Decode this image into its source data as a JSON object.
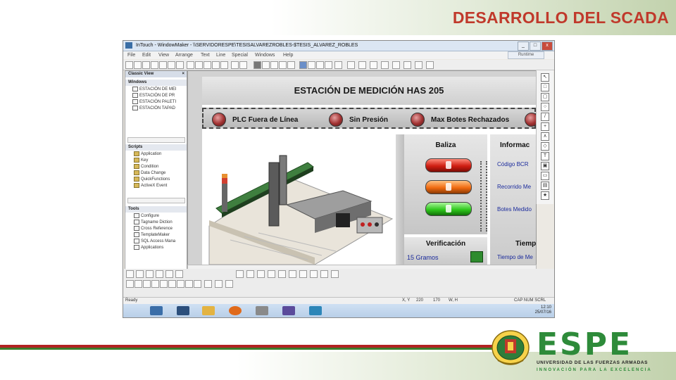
{
  "slide": {
    "title": "DESARROLLO DEL SCADA",
    "logo": {
      "brand": "ESPE",
      "university": "UNIVERSIDAD DE LAS FUERZAS ARMADAS",
      "motto": "INNOVACIÓN PARA LA EXCELENCIA",
      "brand_color": "#2e8b3a",
      "title_color": "#c0392b"
    }
  },
  "window": {
    "title": "InTouch - WindowMaker - \\\\SERVIDORESPE\\TESISALVAREZROBLES-$TESIS_ALVAREZ_ROBLES",
    "menu": [
      "File",
      "Edit",
      "View",
      "Arrange",
      "Text",
      "Line",
      "Special",
      "Windows",
      "Help"
    ],
    "right_button": "Runtime",
    "panel_header": "Classic View",
    "sections": {
      "windows": {
        "label": "Windows",
        "items": [
          "ESTACIÓN DE MEI",
          "ESTACIÓN DE PR",
          "ESTACIÓN PALETI",
          "ESTACIÓN TAPAD"
        ]
      },
      "scripts": {
        "label": "Scripts",
        "items": [
          "Application",
          "Key",
          "Condition",
          "Data Change",
          "QuickFunctions",
          "ActiveX Event"
        ]
      },
      "tools": {
        "label": "Tools",
        "items": [
          "Configure",
          "Tagname Diction",
          "Cross Reference",
          "TemplateMaker",
          "SQL Access Mana",
          "Applications"
        ]
      }
    },
    "status": {
      "ready": "Ready",
      "x_label": "X, Y",
      "x": "220",
      "y": "170",
      "wh_label": "W, H",
      "indicators": "CAP NUM SCRL"
    },
    "clock": {
      "time": "12:10",
      "date": "25/07/16"
    }
  },
  "hmi": {
    "title": "ESTACIÓN DE MEDICIÓN HAS 205",
    "alarms": [
      "PLC Fuera de Línea",
      "Sin Presión",
      "Max Botes Rechazados"
    ],
    "baliza": {
      "label": "Baliza"
    },
    "info": {
      "label": "Informac",
      "rows": [
        "Código BCR",
        "Recorrido Me",
        "Botes Medido"
      ]
    },
    "verificacion": {
      "label": "Verificación",
      "value": "15 Gramos"
    },
    "tiempo": {
      "label": "Tiemp",
      "value": "Tiempo de Me"
    }
  }
}
